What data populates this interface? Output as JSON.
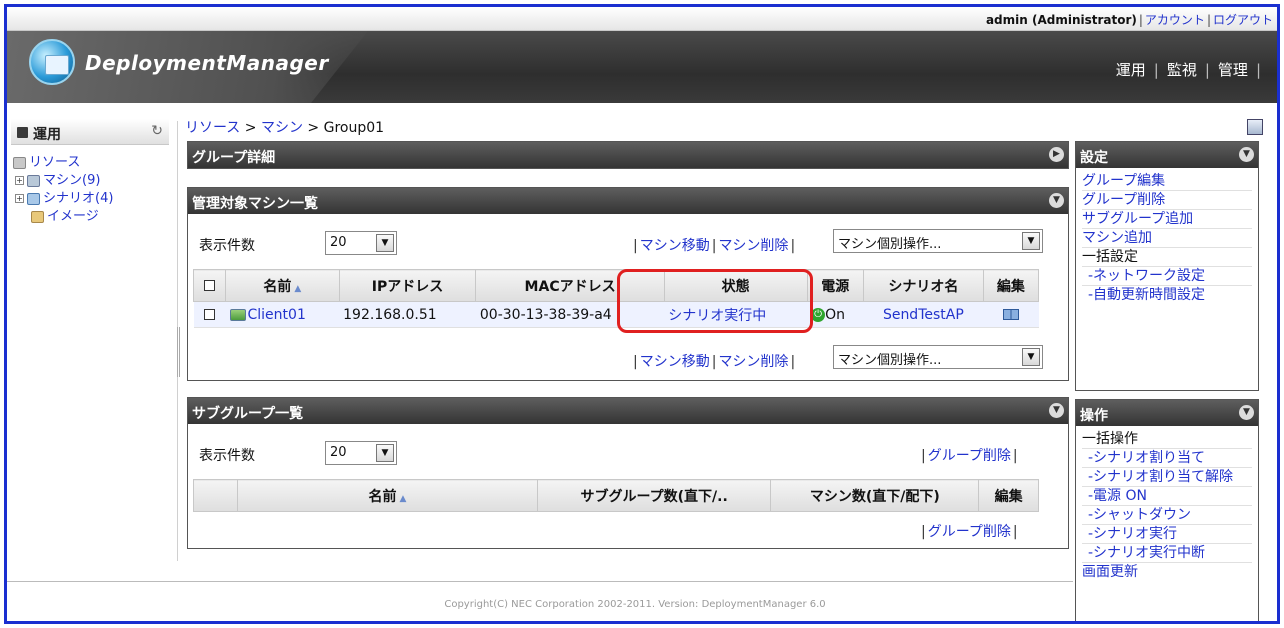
{
  "userbar": {
    "user": "admin (Administrator)",
    "account": "アカウント",
    "logout": "ログアウト"
  },
  "header": {
    "brand": "DeploymentManager",
    "nav": [
      "運用",
      "監視",
      "管理"
    ]
  },
  "sidebar": {
    "title": "運用",
    "items": [
      {
        "label": "リソース"
      },
      {
        "label": "マシン(9)"
      },
      {
        "label": "シナリオ(4)"
      },
      {
        "label": "イメージ"
      }
    ]
  },
  "breadcrumb": {
    "part1": "リソース",
    "part2": "マシン",
    "part3": "Group01",
    "sep": " > "
  },
  "group_detail": {
    "title": "グループ詳細"
  },
  "machines_panel": {
    "title": "管理対象マシン一覧",
    "count_label": "表示件数",
    "count_value": "20",
    "move": "マシン移動",
    "delete": "マシン削除",
    "ops_select": "マシン個別操作...",
    "columns": [
      "名前",
      "IPアドレス",
      "MACアドレス",
      "状態",
      "電源",
      "シナリオ名",
      "編集"
    ],
    "rows": [
      {
        "name": "Client01",
        "ip": "192.168.0.51",
        "mac": "00-30-13-38-39-a4",
        "status": "シナリオ実行中",
        "power": "On",
        "scenario": "SendTestAP"
      }
    ]
  },
  "subgroups_panel": {
    "title": "サブグループ一覧",
    "count_label": "表示件数",
    "count_value": "20",
    "delete": "グループ削除",
    "columns": [
      "名前",
      "サブグループ数(直下/..",
      "マシン数(直下/配下)",
      "編集"
    ]
  },
  "settings_panel": {
    "title": "設定",
    "links": [
      "グループ編集",
      "グループ削除",
      "サブグループ追加",
      "マシン追加"
    ],
    "bulk_label": "一括設定",
    "bulk_links": [
      "-ネットワーク設定",
      "-自動更新時間設定"
    ]
  },
  "operations_panel": {
    "title": "操作",
    "bulk_label": "一括操作",
    "bulk_links": [
      "-シナリオ割り当て",
      "-シナリオ割り当て解除",
      "-電源 ON",
      "-シャットダウン",
      "-シナリオ実行",
      "-シナリオ実行中断"
    ],
    "refresh": "画面更新"
  },
  "footer": {
    "copyright": "Copyright(C) NEC Corporation 2002-2011. Version: DeploymentManager 6.0"
  },
  "colors": {
    "link": "#2233cc",
    "header": "#343434",
    "highlight": "#e02020"
  }
}
